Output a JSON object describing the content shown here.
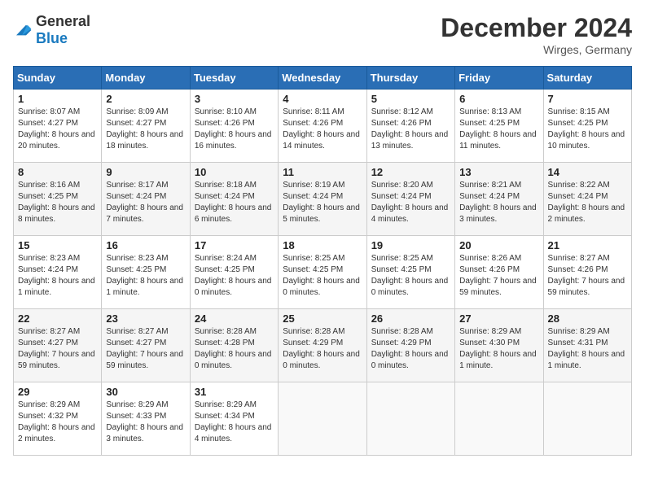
{
  "logo": {
    "general": "General",
    "blue": "Blue"
  },
  "header": {
    "month": "December 2024",
    "location": "Wirges, Germany"
  },
  "weekdays": [
    "Sunday",
    "Monday",
    "Tuesday",
    "Wednesday",
    "Thursday",
    "Friday",
    "Saturday"
  ],
  "weeks": [
    [
      {
        "day": "1",
        "sunrise": "8:07 AM",
        "sunset": "4:27 PM",
        "daylight": "8 hours and 20 minutes."
      },
      {
        "day": "2",
        "sunrise": "8:09 AM",
        "sunset": "4:27 PM",
        "daylight": "8 hours and 18 minutes."
      },
      {
        "day": "3",
        "sunrise": "8:10 AM",
        "sunset": "4:26 PM",
        "daylight": "8 hours and 16 minutes."
      },
      {
        "day": "4",
        "sunrise": "8:11 AM",
        "sunset": "4:26 PM",
        "daylight": "8 hours and 14 minutes."
      },
      {
        "day": "5",
        "sunrise": "8:12 AM",
        "sunset": "4:26 PM",
        "daylight": "8 hours and 13 minutes."
      },
      {
        "day": "6",
        "sunrise": "8:13 AM",
        "sunset": "4:25 PM",
        "daylight": "8 hours and 11 minutes."
      },
      {
        "day": "7",
        "sunrise": "8:15 AM",
        "sunset": "4:25 PM",
        "daylight": "8 hours and 10 minutes."
      }
    ],
    [
      {
        "day": "8",
        "sunrise": "8:16 AM",
        "sunset": "4:25 PM",
        "daylight": "8 hours and 8 minutes."
      },
      {
        "day": "9",
        "sunrise": "8:17 AM",
        "sunset": "4:24 PM",
        "daylight": "8 hours and 7 minutes."
      },
      {
        "day": "10",
        "sunrise": "8:18 AM",
        "sunset": "4:24 PM",
        "daylight": "8 hours and 6 minutes."
      },
      {
        "day": "11",
        "sunrise": "8:19 AM",
        "sunset": "4:24 PM",
        "daylight": "8 hours and 5 minutes."
      },
      {
        "day": "12",
        "sunrise": "8:20 AM",
        "sunset": "4:24 PM",
        "daylight": "8 hours and 4 minutes."
      },
      {
        "day": "13",
        "sunrise": "8:21 AM",
        "sunset": "4:24 PM",
        "daylight": "8 hours and 3 minutes."
      },
      {
        "day": "14",
        "sunrise": "8:22 AM",
        "sunset": "4:24 PM",
        "daylight": "8 hours and 2 minutes."
      }
    ],
    [
      {
        "day": "15",
        "sunrise": "8:23 AM",
        "sunset": "4:24 PM",
        "daylight": "8 hours and 1 minute."
      },
      {
        "day": "16",
        "sunrise": "8:23 AM",
        "sunset": "4:25 PM",
        "daylight": "8 hours and 1 minute."
      },
      {
        "day": "17",
        "sunrise": "8:24 AM",
        "sunset": "4:25 PM",
        "daylight": "8 hours and 0 minutes."
      },
      {
        "day": "18",
        "sunrise": "8:25 AM",
        "sunset": "4:25 PM",
        "daylight": "8 hours and 0 minutes."
      },
      {
        "day": "19",
        "sunrise": "8:25 AM",
        "sunset": "4:25 PM",
        "daylight": "8 hours and 0 minutes."
      },
      {
        "day": "20",
        "sunrise": "8:26 AM",
        "sunset": "4:26 PM",
        "daylight": "7 hours and 59 minutes."
      },
      {
        "day": "21",
        "sunrise": "8:27 AM",
        "sunset": "4:26 PM",
        "daylight": "7 hours and 59 minutes."
      }
    ],
    [
      {
        "day": "22",
        "sunrise": "8:27 AM",
        "sunset": "4:27 PM",
        "daylight": "7 hours and 59 minutes."
      },
      {
        "day": "23",
        "sunrise": "8:27 AM",
        "sunset": "4:27 PM",
        "daylight": "7 hours and 59 minutes."
      },
      {
        "day": "24",
        "sunrise": "8:28 AM",
        "sunset": "4:28 PM",
        "daylight": "8 hours and 0 minutes."
      },
      {
        "day": "25",
        "sunrise": "8:28 AM",
        "sunset": "4:29 PM",
        "daylight": "8 hours and 0 minutes."
      },
      {
        "day": "26",
        "sunrise": "8:28 AM",
        "sunset": "4:29 PM",
        "daylight": "8 hours and 0 minutes."
      },
      {
        "day": "27",
        "sunrise": "8:29 AM",
        "sunset": "4:30 PM",
        "daylight": "8 hours and 1 minute."
      },
      {
        "day": "28",
        "sunrise": "8:29 AM",
        "sunset": "4:31 PM",
        "daylight": "8 hours and 1 minute."
      }
    ],
    [
      {
        "day": "29",
        "sunrise": "8:29 AM",
        "sunset": "4:32 PM",
        "daylight": "8 hours and 2 minutes."
      },
      {
        "day": "30",
        "sunrise": "8:29 AM",
        "sunset": "4:33 PM",
        "daylight": "8 hours and 3 minutes."
      },
      {
        "day": "31",
        "sunrise": "8:29 AM",
        "sunset": "4:34 PM",
        "daylight": "8 hours and 4 minutes."
      },
      null,
      null,
      null,
      null
    ]
  ]
}
